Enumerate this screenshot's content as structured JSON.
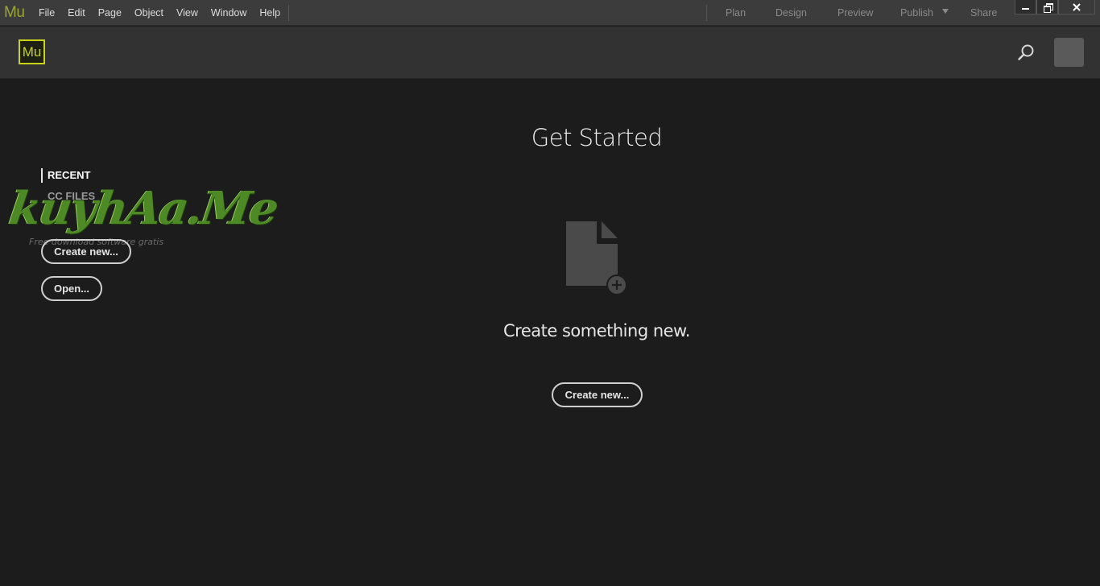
{
  "menubar": {
    "app_mark": "Mu",
    "menus": [
      "File",
      "Edit",
      "Page",
      "Object",
      "View",
      "Window",
      "Help"
    ],
    "modes": {
      "plan": "Plan",
      "design": "Design",
      "preview": "Preview",
      "publish": "Publish",
      "share": "Share"
    }
  },
  "header": {
    "logo_text": "Mu",
    "search_icon": "search-icon",
    "accent_color": "#c9d31a"
  },
  "left_panel": {
    "tabs": {
      "recent": "RECENT",
      "cc_files": "CC FILES"
    },
    "create_label": "Create new...",
    "open_label": "Open..."
  },
  "watermark": {
    "brand": "kuyhAa.Me",
    "tagline": "Free download software gratis"
  },
  "main": {
    "title": "Get Started",
    "icon": "new-document-icon",
    "subtitle": "Create something new.",
    "create_label": "Create new..."
  }
}
